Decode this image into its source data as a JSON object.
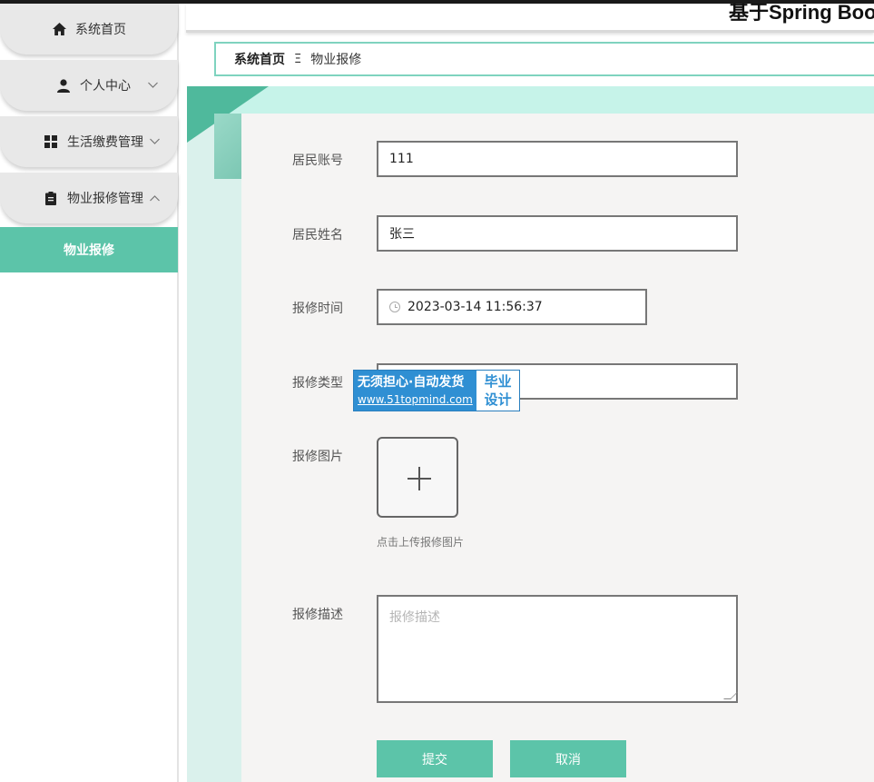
{
  "header": {
    "title": "基于Spring Boot"
  },
  "sidebar": {
    "items": [
      {
        "label": "系统首页",
        "icon": "home-icon",
        "expandable": false
      },
      {
        "label": "个人中心",
        "icon": "user-icon",
        "expandable": true,
        "expanded": false
      },
      {
        "label": "生活缴费管理",
        "icon": "grid-icon",
        "expandable": true,
        "expanded": false
      },
      {
        "label": "物业报修管理",
        "icon": "clipboard-icon",
        "expandable": true,
        "expanded": true
      }
    ],
    "active_sub": "物业报修"
  },
  "breadcrumb": {
    "home": "系统首页",
    "separator": "Ξ",
    "current": "物业报修"
  },
  "form": {
    "account": {
      "label": "居民账号",
      "value": "111"
    },
    "name": {
      "label": "居民姓名",
      "value": "张三"
    },
    "time": {
      "label": "报修时间",
      "value": "2023-03-14 11:56:37"
    },
    "type": {
      "label": "报修类型",
      "value": ""
    },
    "image": {
      "label": "报修图片",
      "tip": "点击上传报修图片"
    },
    "description": {
      "label": "报修描述",
      "placeholder": "报修描述"
    },
    "submit_label": "提交",
    "cancel_label": "取消"
  },
  "watermark": {
    "line1": "无须担心·自动发货",
    "line2": "www.51topmind.com",
    "badge_top": "毕业",
    "badge_bottom": "设计"
  },
  "colors": {
    "accent": "#5cc4a9",
    "mint": "#c6f3e9",
    "watermark_blue": "#2f8fd3"
  }
}
